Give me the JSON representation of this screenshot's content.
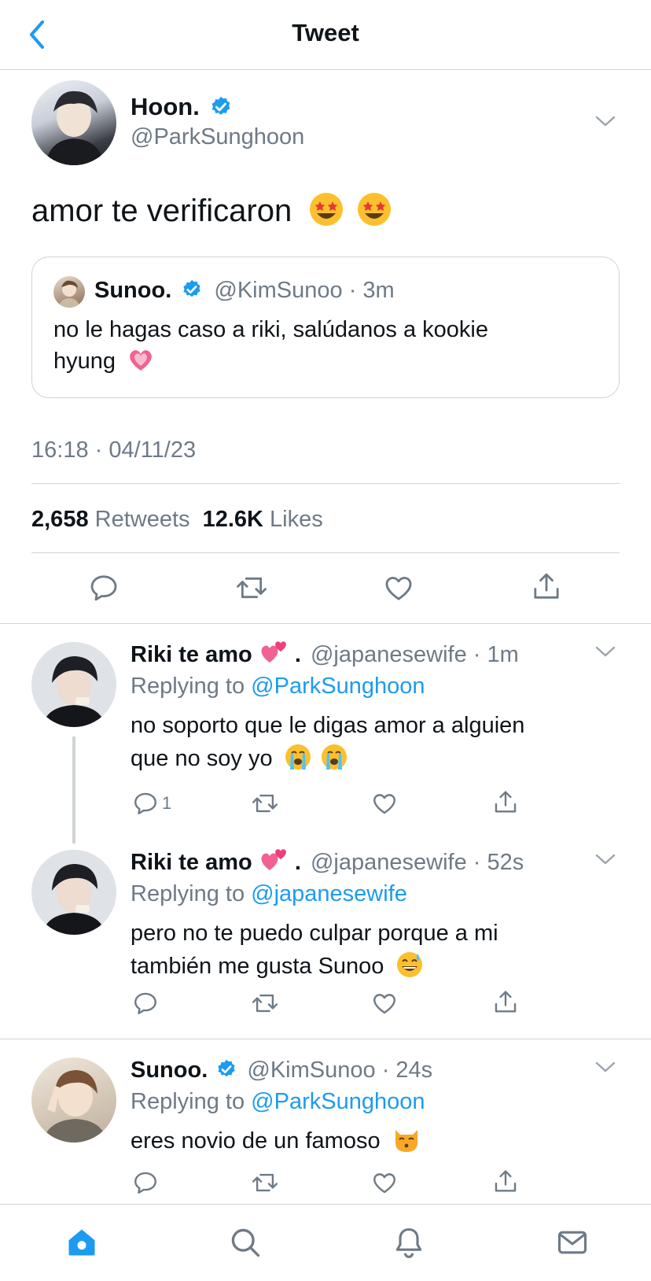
{
  "header": {
    "title": "Tweet"
  },
  "tweet": {
    "name": "Hoon.",
    "handle": "@ParkSunghoon",
    "text": "amor te verificaron",
    "quote": {
      "name": "Sunoo.",
      "handle": "@KimSunoo",
      "time": "3m",
      "text_line1": "no le hagas caso a riki, salúdanos a kookie",
      "text_line2": "hyung"
    },
    "timestamp": "16:18 · 04/11/23",
    "retweets_count": "2,658",
    "retweets_label": "Retweets",
    "likes_count": "12.6K",
    "likes_label": "Likes"
  },
  "replies": [
    {
      "name": "Riki te amo",
      "name_suffix": ".",
      "handle": "@japanesewife",
      "time": "1m",
      "replying_label": "Replying to",
      "replying_to": "@ParkSunghoon",
      "line1": "no soporto que le digas amor a alguien",
      "line2": "que no soy yo",
      "reply_count": "1"
    },
    {
      "name": "Riki te amo",
      "name_suffix": ".",
      "handle": "@japanesewife",
      "time": "52s",
      "replying_label": "Replying to",
      "replying_to": "@japanesewife",
      "line1": "pero no te puedo culpar porque a mi",
      "line2": "también me gusta Sunoo"
    },
    {
      "name": "Sunoo.",
      "handle": "@KimSunoo",
      "time": "24s",
      "replying_label": "Replying to",
      "replying_to": "@ParkSunghoon",
      "line1": "eres novio de un famoso"
    }
  ],
  "colors": {
    "accent": "#1d9bf0",
    "muted": "#6e7a86",
    "divider": "#cfd4d9"
  },
  "icons": [
    "back-chevron-icon",
    "chevron-down-icon",
    "verified-badge-icon",
    "reply-icon",
    "retweet-icon",
    "like-icon",
    "share-icon",
    "home-icon",
    "search-icon",
    "notifications-icon",
    "messages-icon"
  ]
}
